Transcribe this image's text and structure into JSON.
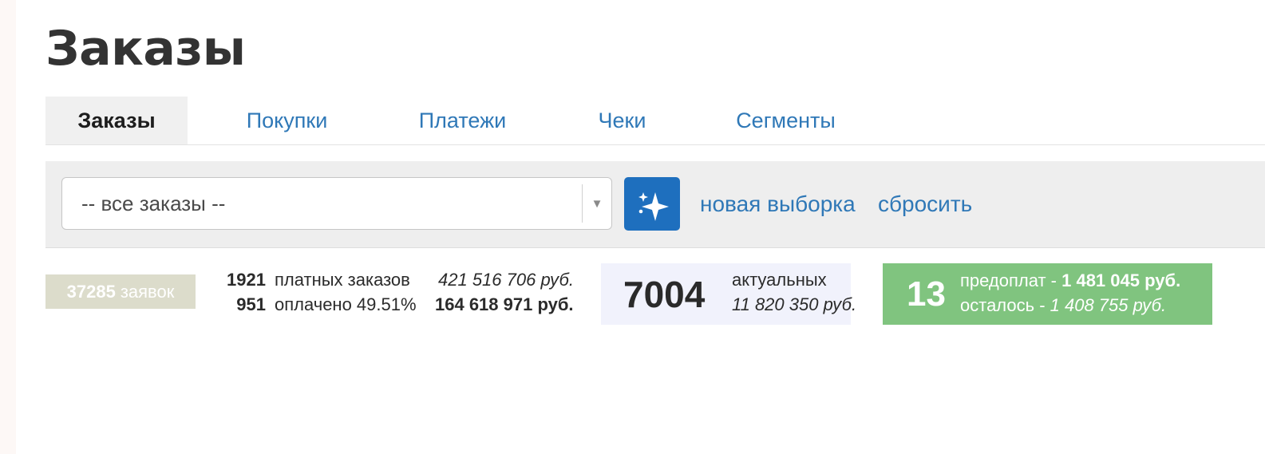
{
  "page": {
    "title": "Заказы"
  },
  "tabs": [
    {
      "label": "Заказы",
      "active": true
    },
    {
      "label": "Покупки",
      "active": false
    },
    {
      "label": "Платежи",
      "active": false
    },
    {
      "label": "Чеки",
      "active": false
    },
    {
      "label": "Сегменты",
      "active": false
    }
  ],
  "filter": {
    "selected": "-- все заказы --",
    "arrow_glyph": "▼",
    "magic_icon": "sparkles-icon",
    "new_selection_label": "новая выборка",
    "reset_label": "сбросить"
  },
  "stats": {
    "requests": {
      "count": "37285",
      "label": "заявок"
    },
    "paid": {
      "count": "1921",
      "label": "платных заказов",
      "sum": "421 516 706 руб."
    },
    "payed": {
      "count": "951",
      "label": "оплачено 49.51%",
      "sum": "164 618 971 руб."
    },
    "actual": {
      "count": "7004",
      "label": "актуальных",
      "sum": "11 820 350 руб."
    },
    "prepay": {
      "count": "13",
      "label1": "предоплат - ",
      "sum1": "1 481 045 руб.",
      "label2": "осталось - ",
      "sum2": "1 408 755 руб."
    }
  },
  "colors": {
    "accent": "#2f78b7",
    "button": "#1e6fbe",
    "requests_badge": "#dcdccb",
    "actual_bg": "#f1f2fc",
    "prepay_bg": "#80c47f"
  }
}
